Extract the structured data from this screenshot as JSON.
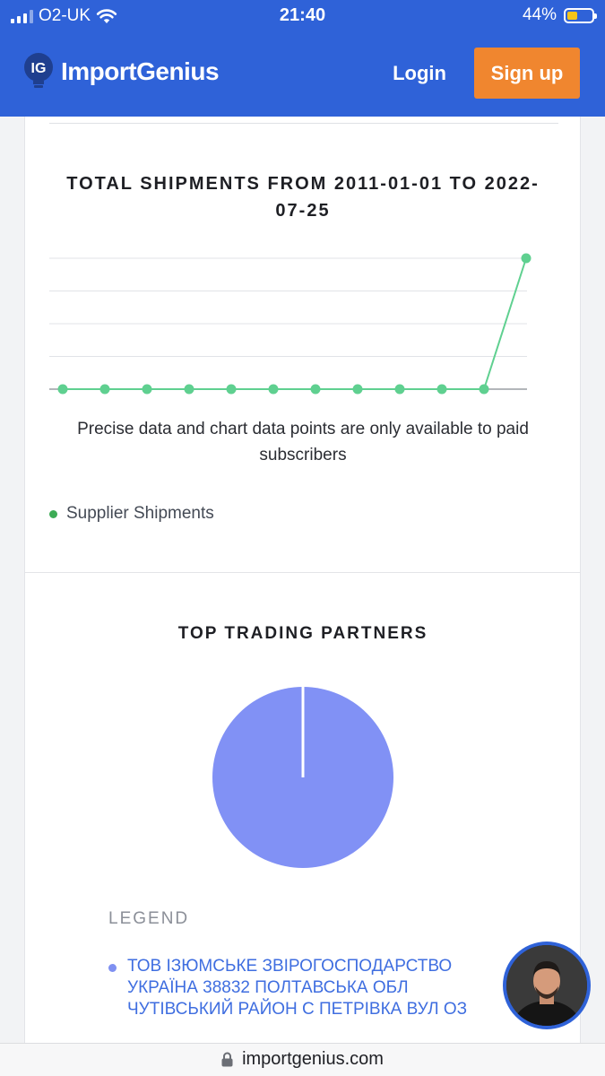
{
  "status_bar": {
    "carrier": "O2-UK",
    "time": "21:40",
    "battery_percent": "44%",
    "battery_level": 0.44
  },
  "header": {
    "brand": "ImportGenius",
    "logo_mark": "IG",
    "login_label": "Login",
    "signup_label": "Sign up",
    "colors": {
      "bar": "#2f62d8",
      "signup": "#f0862f"
    }
  },
  "shipments": {
    "title": "TOTAL SHIPMENTS FROM 2011-01-01 TO 2022-07-25",
    "notice": "Precise data and chart data points are only available to paid subscribers",
    "legend_label": "Supplier Shipments"
  },
  "chart_data": [
    {
      "type": "line",
      "title": "TOTAL SHIPMENTS FROM 2011-01-01 TO 2022-07-25",
      "x": [
        1,
        2,
        3,
        4,
        5,
        6,
        7,
        8,
        9,
        10,
        11,
        12
      ],
      "series": [
        {
          "name": "Supplier Shipments",
          "values": [
            0,
            0,
            0,
            0,
            0,
            0,
            0,
            0,
            0,
            0,
            0,
            4
          ],
          "color": "#5fd090"
        }
      ],
      "ylim": [
        0,
        4
      ],
      "grid": true,
      "legend": "bottom-left"
    },
    {
      "type": "pie",
      "title": "TOP TRADING PARTNERS",
      "slices": [
        {
          "name": "ТОВ ІЗЮМСЬКЕ ЗВІРОГОСПОДАРСТВО УКРАЇНА 38832 ПОЛТАВСЬКА ОБЛ ЧУТІВСЬКИЙ РАЙОН С ПЕТРІВКА ВУЛ ОЗ",
          "value": 100,
          "color": "#8191f5"
        }
      ],
      "legend": "bottom"
    }
  ],
  "partners": {
    "title": "TOP TRADING PARTNERS",
    "legend_heading": "LEGEND",
    "legend_item": "ТОВ ІЗЮМСЬКЕ ЗВІРОГОСПОДАРСТВО УКРАЇНА 38832 ПОЛТАВСЬКА ОБЛ ЧУТІВСЬКИЙ РАЙОН С ПЕТРІВКА ВУЛ ОЗ"
  },
  "url_bar": {
    "url": "importgenius.com",
    "icon": "lock-icon"
  }
}
